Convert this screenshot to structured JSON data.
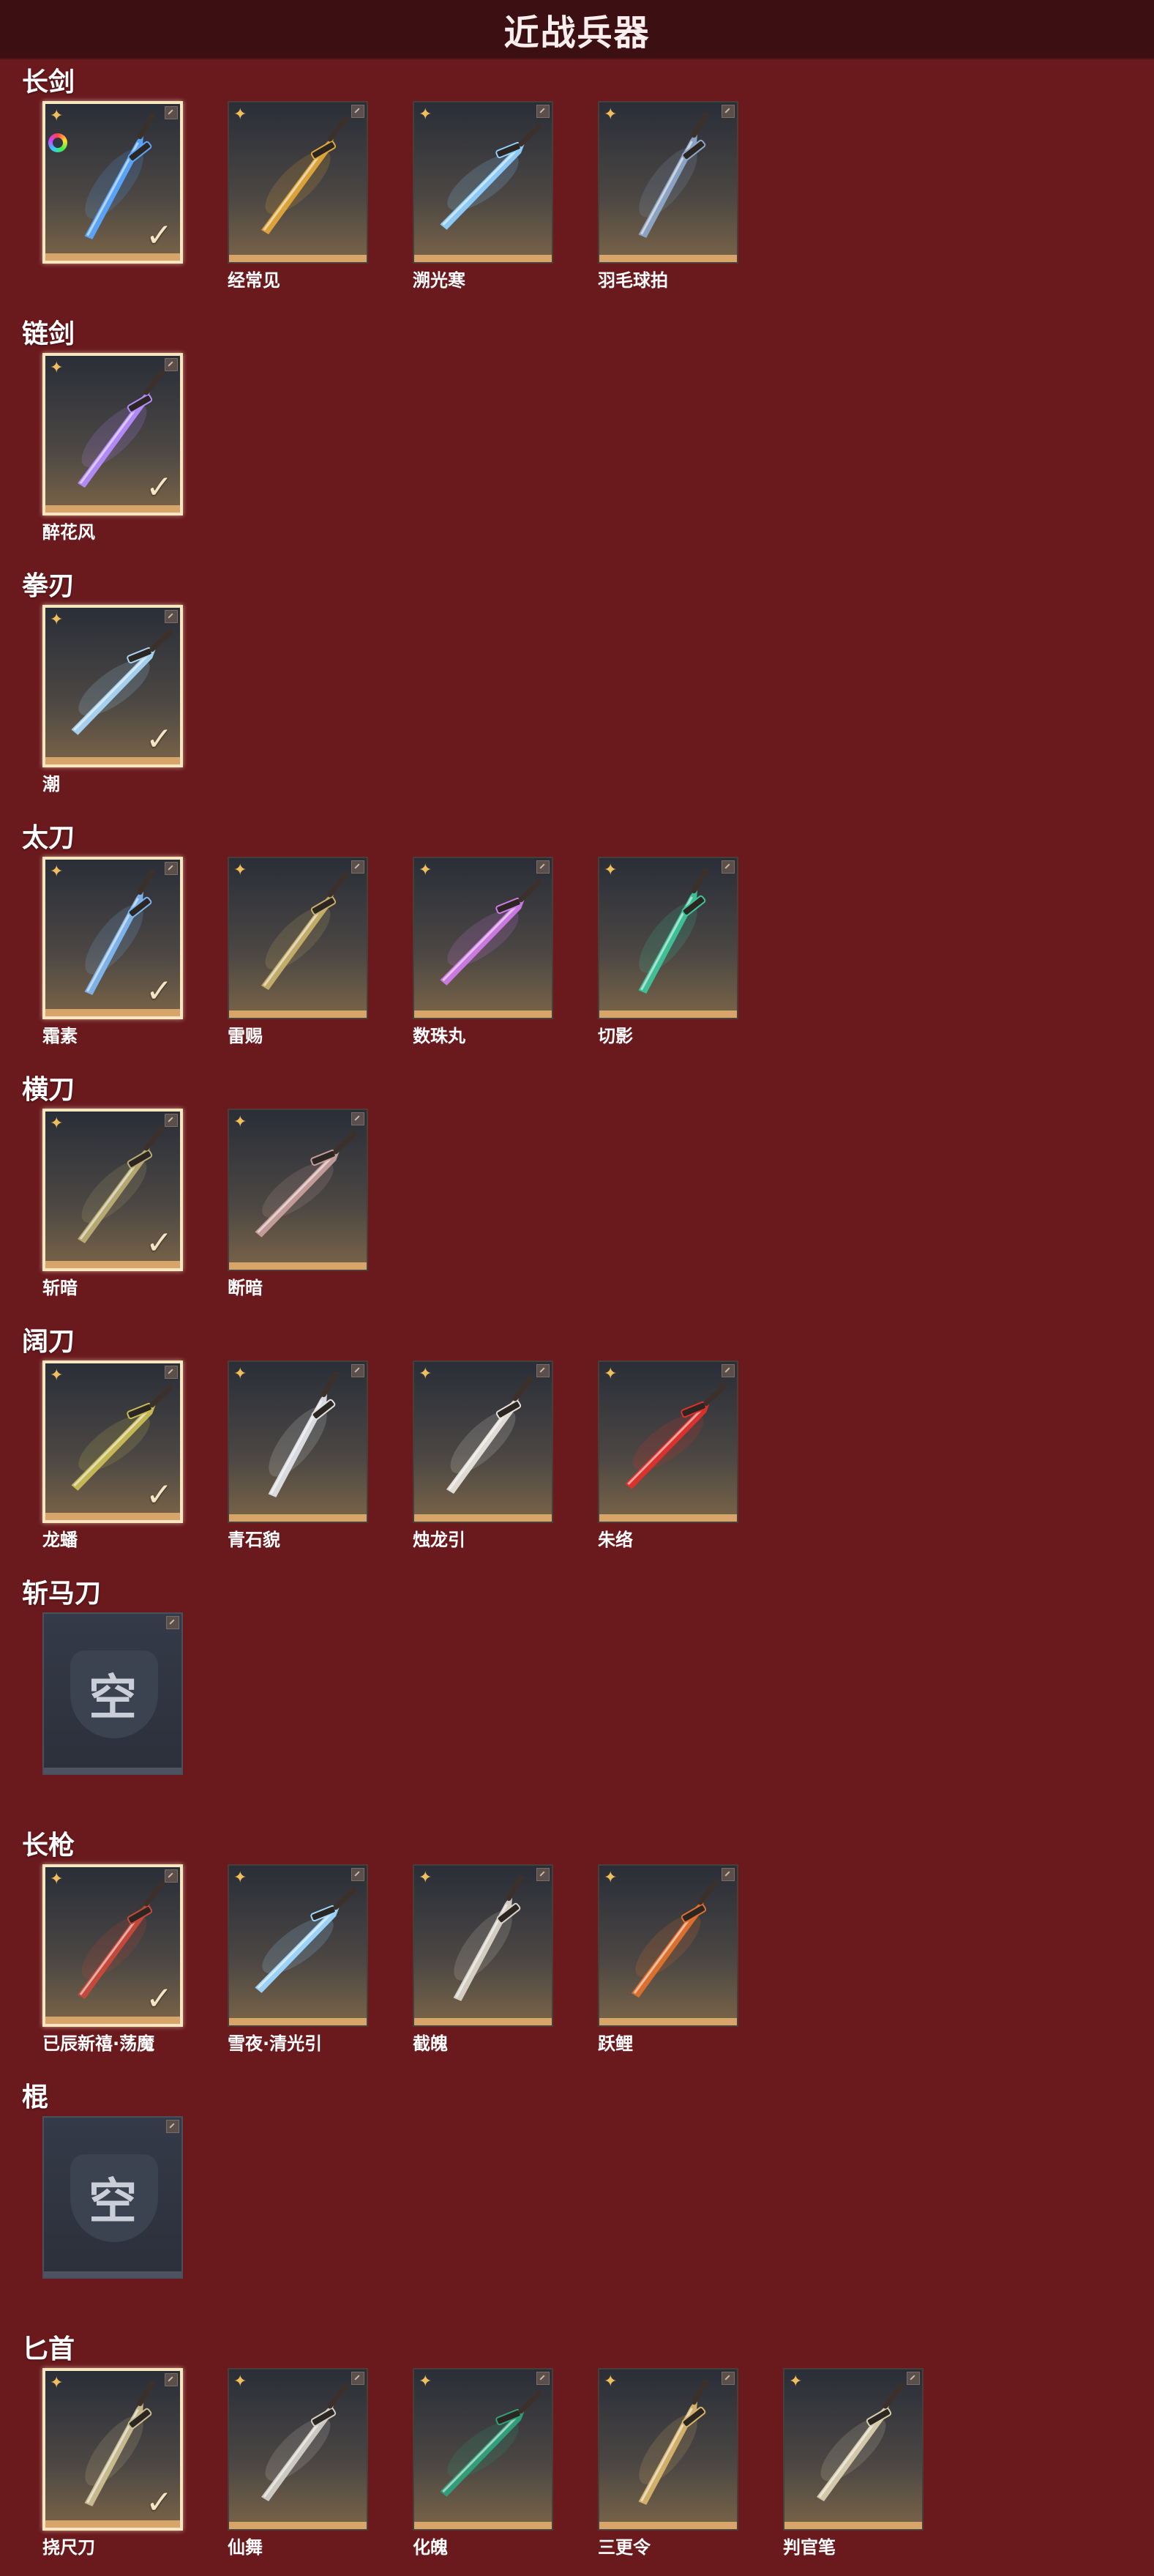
{
  "title": "近战兵器",
  "empty_label": "空",
  "categories": [
    {
      "name": "长剑",
      "items": [
        {
          "name": "",
          "selected": true,
          "special": true,
          "color": "#5aa6ff"
        },
        {
          "name": "经常见",
          "selected": false,
          "color": "#e1a63a"
        },
        {
          "name": "溯光寒",
          "selected": false,
          "color": "#8fd0ff"
        },
        {
          "name": "羽毛球拍",
          "selected": false,
          "color": "#8ea6c8"
        }
      ]
    },
    {
      "name": "链剑",
      "items": [
        {
          "name": "醉花风",
          "selected": true,
          "color": "#b58cff"
        }
      ]
    },
    {
      "name": "拳刃",
      "items": [
        {
          "name": "潮",
          "selected": true,
          "color": "#a9d6f5"
        }
      ]
    },
    {
      "name": "太刀",
      "items": [
        {
          "name": "霜素",
          "selected": true,
          "color": "#7fb6f0"
        },
        {
          "name": "雷赐",
          "selected": false,
          "color": "#c7b06a"
        },
        {
          "name": "数珠丸",
          "selected": false,
          "color": "#d07be8"
        },
        {
          "name": "切影",
          "selected": false,
          "color": "#3fc49a"
        }
      ]
    },
    {
      "name": "横刀",
      "items": [
        {
          "name": "斩暗",
          "selected": true,
          "color": "#b9ad73"
        },
        {
          "name": "断暗",
          "selected": false,
          "color": "#c79f9c"
        }
      ]
    },
    {
      "name": "阔刀",
      "items": [
        {
          "name": "龙蟠",
          "selected": true,
          "color": "#c9bd55"
        },
        {
          "name": "青石貌",
          "selected": false,
          "color": "#dfe2e5"
        },
        {
          "name": "烛龙引",
          "selected": false,
          "color": "#e6e2db"
        },
        {
          "name": "朱络",
          "selected": false,
          "color": "#e0302c"
        }
      ]
    },
    {
      "name": "斩马刀",
      "items": [
        {
          "name": "",
          "selected": false,
          "empty": true
        }
      ]
    },
    {
      "name": "长枪",
      "items": [
        {
          "name": "已辰新禧·荡魔",
          "selected": true,
          "color": "#c9493a"
        },
        {
          "name": "雪夜·清光引",
          "selected": false,
          "color": "#9fd8ff"
        },
        {
          "name": "截魄",
          "selected": false,
          "color": "#d9d3c8"
        },
        {
          "name": "跃鲤",
          "selected": false,
          "color": "#e2712d"
        }
      ]
    },
    {
      "name": "棍",
      "items": [
        {
          "name": "",
          "selected": false,
          "empty": true
        }
      ]
    },
    {
      "name": "匕首",
      "items": [
        {
          "name": "挠尺刀",
          "selected": true,
          "color": "#cbbf91"
        },
        {
          "name": "仙舞",
          "selected": false,
          "color": "#d2cfc8"
        },
        {
          "name": "化魄",
          "selected": false,
          "color": "#2fa27c"
        },
        {
          "name": "三更令",
          "selected": false,
          "color": "#d7b46c"
        },
        {
          "name": "判官笔",
          "selected": false,
          "color": "#d9cfaf"
        }
      ]
    }
  ]
}
